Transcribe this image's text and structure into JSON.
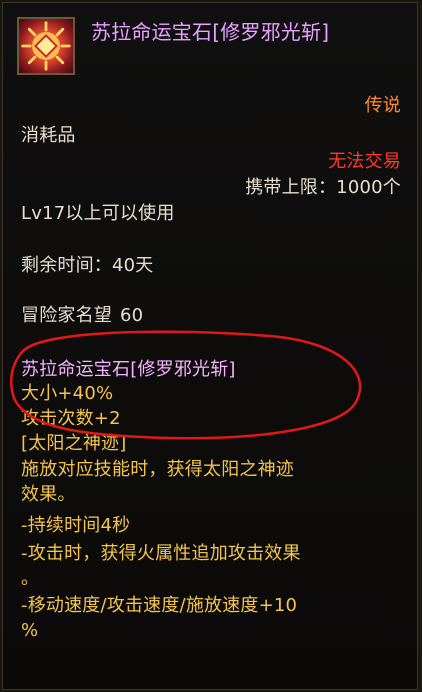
{
  "item": {
    "icon_name": "sun-gem-icon",
    "title": "苏拉命运宝石[修罗邪光斩]",
    "rarity": "传说",
    "category": "消耗品",
    "trade_status": "无法交易",
    "carry_limit": "携带上限：1000个",
    "level_req": "Lv17以上可以使用",
    "remaining_time": "剩余时间：40天",
    "fame_label": "冒险家名望",
    "fame_value": "60"
  },
  "enchant": {
    "name": "苏拉命运宝石[修罗邪光斩]",
    "size_line": "大小+40%",
    "attack_count_line": "攻击次数+2",
    "skill_name": "[太阳之神迹]",
    "description_lines": [
      "施放对应技能时，获得太阳之神迹",
      "效果。",
      "-持续时间4秒",
      "-攻击时，获得火属性追加攻击效果",
      "。",
      "-移动速度/攻击速度/施放速度+10",
      "%"
    ]
  },
  "colors": {
    "title": "#e7a3ff",
    "rarity": "#ff8c2a",
    "trade": "#ff3a2e",
    "normal": "#e6dfcf",
    "effect": "#f3c54a",
    "annotation": "#e01818"
  }
}
